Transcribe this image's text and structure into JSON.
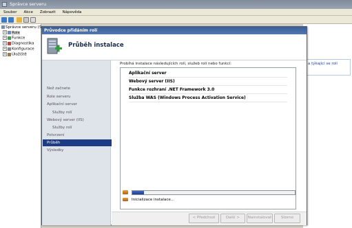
{
  "window": {
    "title": "Správce serveru"
  },
  "menu": [
    "Soubor",
    "Akce",
    "Zobrazit",
    "Nápověda"
  ],
  "tree": {
    "items": [
      {
        "label": "Správce serveru (S",
        "expander": ""
      },
      {
        "label": "Role",
        "expander": "+"
      },
      {
        "label": "Funkce",
        "expander": "+"
      },
      {
        "label": "Diagnostika",
        "expander": "+"
      },
      {
        "label": "Konfigurace",
        "expander": "+"
      },
      {
        "label": "Úložiště",
        "expander": "+"
      }
    ]
  },
  "right_pane": {
    "link": "a týkající se rolí"
  },
  "wizard": {
    "title": "Průvodce přidáním rolí",
    "heading": "Průběh instalace",
    "nav": [
      {
        "label": "Než začnete",
        "sub": false,
        "active": false
      },
      {
        "label": "Role serveru",
        "sub": false,
        "active": false
      },
      {
        "label": "Aplikační server",
        "sub": false,
        "active": false
      },
      {
        "label": "Služby rolí",
        "sub": true,
        "active": false
      },
      {
        "label": "Webový server (IIS)",
        "sub": false,
        "active": false
      },
      {
        "label": "Služby rolí",
        "sub": true,
        "active": false
      },
      {
        "label": "Potvrzení",
        "sub": false,
        "active": false
      },
      {
        "label": "Průběh",
        "sub": false,
        "active": true
      },
      {
        "label": "Výsledky",
        "sub": false,
        "active": false
      }
    ],
    "description": "Probíhá instalace následujících rolí, služeb rolí nebo funkcí:",
    "roles": [
      "Aplikační server",
      "Webový server (IIS)",
      "Funkce rozhraní .NET Framework 3.0",
      "Služba WAS (Windows Process Activation Service)"
    ],
    "progress": 0.07,
    "status": "Inicializace instalace...",
    "buttons": {
      "prev": "< Předchozí",
      "next": "Další >",
      "install": "Nainstalovat",
      "cancel": "Storno"
    }
  }
}
